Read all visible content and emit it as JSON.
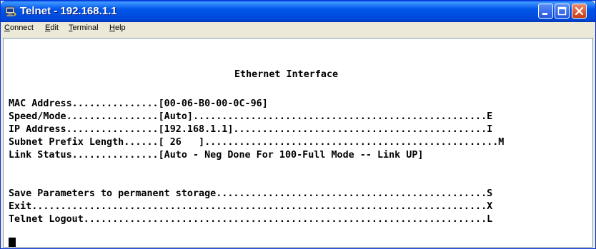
{
  "window": {
    "title": "Telnet - 192.168.1.1"
  },
  "menu": [
    {
      "accel": "C",
      "rest": "onnect"
    },
    {
      "accel": "E",
      "rest": "dit"
    },
    {
      "accel": "T",
      "rest": "erminal"
    },
    {
      "accel": "H",
      "rest": "elp"
    }
  ],
  "terminal": {
    "heading": "Ethernet Interface",
    "fields": [
      "MAC Address...............[00-06-B0-00-0C-96]",
      "Speed/Mode................[Auto]...................................................E",
      "IP Address................[192.168.1.1]............................................I",
      "Subnet Prefix Length......[ 26   ]...................................................M",
      "Link Status...............[Auto - Neg Done For 100-Full Mode -- Link UP]"
    ],
    "actions": [
      "Save Parameters to permanent storage...............................................S",
      "Exit...............................................................................X",
      "Telnet Logout......................................................................L"
    ]
  },
  "colors": {
    "titlebar": "#0055ea",
    "chrome": "#ece9d8",
    "terminal_bg": "#ffffff",
    "terminal_fg": "#000000"
  }
}
